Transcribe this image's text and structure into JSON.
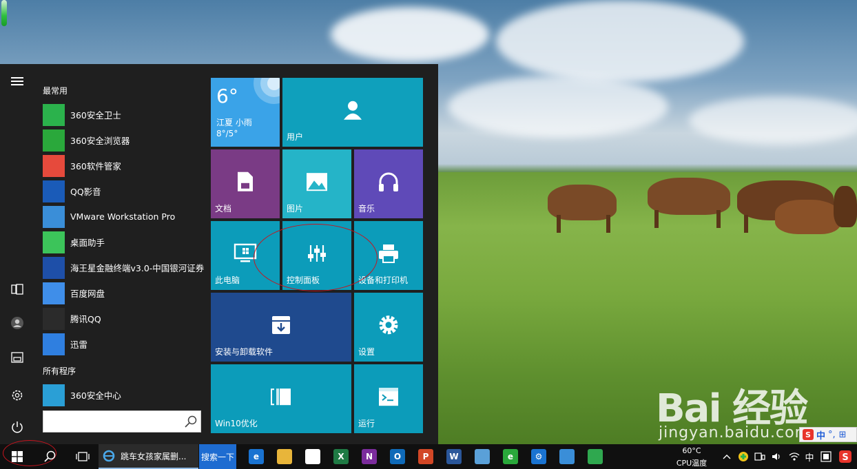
{
  "start_menu": {
    "most_used_header": "最常用",
    "all_programs_header": "所有程序",
    "apps": [
      {
        "label": "360安全卫士",
        "icon": "360-safe-guard-icon",
        "color": "#2bb24c"
      },
      {
        "label": "360安全浏览器",
        "icon": "360-browser-icon",
        "color": "#2aa83b"
      },
      {
        "label": "360软件管家",
        "icon": "360-software-manager-icon",
        "color": "#e64a3c"
      },
      {
        "label": "QQ影音",
        "icon": "qq-player-icon",
        "color": "#1a5bb8"
      },
      {
        "label": "VMware Workstation Pro",
        "icon": "vmware-icon",
        "color": "#3a8ed8"
      },
      {
        "label": "桌面助手",
        "icon": "desktop-assistant-icon",
        "color": "#3cc45a"
      },
      {
        "label": "海王星金融终端v3.0-中国银河证券",
        "icon": "neptune-finance-icon",
        "color": "#1e4fa8"
      },
      {
        "label": "百度网盘",
        "icon": "baidu-netdisk-icon",
        "color": "#3f8ee9"
      },
      {
        "label": "腾讯QQ",
        "icon": "tencent-qq-icon",
        "color": "#2b2b2b"
      },
      {
        "label": "迅雷",
        "icon": "xunlei-icon",
        "color": "#2f7fe0"
      }
    ],
    "all_programs_apps": [
      {
        "label": "360安全中心",
        "icon": "folder-icon",
        "color": "#2a9fd6"
      }
    ],
    "rail_icons": [
      "hamburger-menu-icon",
      "explorer-icon",
      "user-icon",
      "documents-icon",
      "settings-icon",
      "power-icon"
    ]
  },
  "tiles": {
    "weather": {
      "temp": "6°",
      "location": "江夏 小雨",
      "range": "8°/5°",
      "color": "#3aa3e8"
    },
    "user": {
      "label": "用户",
      "color": "#0fa0bc"
    },
    "documents": {
      "label": "文档",
      "color": "#7a3b85"
    },
    "pictures": {
      "label": "图片",
      "color": "#25b4c8"
    },
    "music": {
      "label": "音乐",
      "color": "#5f4ab8"
    },
    "this_pc": {
      "label": "此电脑",
      "color": "#0c9cba"
    },
    "control_panel": {
      "label": "控制面板",
      "color": "#0c9cba"
    },
    "devices_printers": {
      "label": "设备和打印机",
      "color": "#0c9cba"
    },
    "install_uninstall": {
      "label": "安装与卸载软件",
      "color": "#1f4a8e"
    },
    "settings": {
      "label": "设置",
      "color": "#0c9cba"
    },
    "win10_optimize": {
      "label": "Win10优化",
      "color": "#0c9cba"
    },
    "run": {
      "label": "运行",
      "color": "#0c9cba"
    }
  },
  "taskbar": {
    "ie_task_label": "跳车女孩家属删...",
    "search_button_label": "搜索一下",
    "cpu_temp": "60°C",
    "cpu_label": "CPU温度",
    "ime_lang": "中",
    "ime_label": "中",
    "apps": [
      {
        "name": "edge-icon",
        "color": "#1a73d1",
        "glyph": "e"
      },
      {
        "name": "file-explorer-icon",
        "color": "#e8b53a",
        "glyph": ""
      },
      {
        "name": "store-icon",
        "color": "#ffffff",
        "glyph": ""
      },
      {
        "name": "excel-icon",
        "color": "#1f7a44",
        "glyph": "X"
      },
      {
        "name": "onenote-icon",
        "color": "#7b2c9c",
        "glyph": "N"
      },
      {
        "name": "outlook-icon",
        "color": "#0f6ab8",
        "glyph": "O"
      },
      {
        "name": "powerpoint-icon",
        "color": "#d24726",
        "glyph": "P"
      },
      {
        "name": "word-icon",
        "color": "#2b579a",
        "glyph": "W"
      },
      {
        "name": "paint-icon",
        "color": "#5aa0d8",
        "glyph": ""
      },
      {
        "name": "360-browser-task-icon",
        "color": "#2aa83b",
        "glyph": "e"
      },
      {
        "name": "settings-task-icon",
        "color": "#1a73d1",
        "glyph": "⚙"
      },
      {
        "name": "app-task-icon",
        "color": "#3a8ed8",
        "glyph": ""
      },
      {
        "name": "app-task-icon-2",
        "color": "#2fa84f",
        "glyph": ""
      }
    ]
  },
  "watermark": {
    "logo": "Bai 经验",
    "url": "jingyan.baidu.com"
  }
}
